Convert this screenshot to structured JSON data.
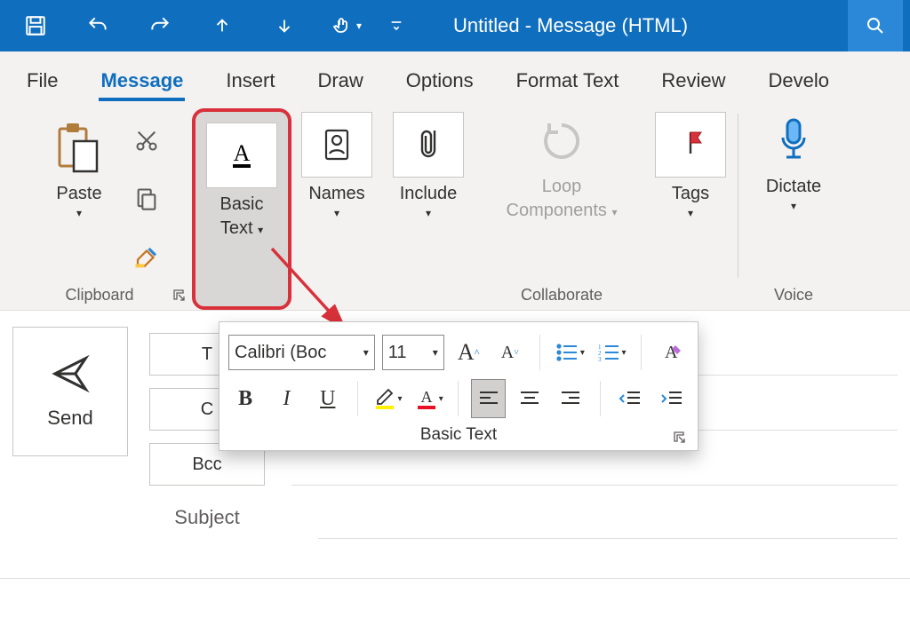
{
  "title": "Untitled  -  Message (HTML)",
  "tabs": {
    "file": "File",
    "message": "Message",
    "insert": "Insert",
    "draw": "Draw",
    "options": "Options",
    "format_text": "Format Text",
    "review": "Review",
    "developer": "Develo"
  },
  "ribbon": {
    "clipboard": {
      "paste": "Paste",
      "label": "Clipboard"
    },
    "basic_text": {
      "btn_line1": "Basic",
      "btn_line2": "Text"
    },
    "names": "Names",
    "include": "Include",
    "loop": {
      "line1": "Loop",
      "line2": "Components"
    },
    "collaborate_label": "Collaborate",
    "tags": "Tags",
    "dictate": "Dictate",
    "voice_label": "Voice"
  },
  "compose": {
    "send": "Send",
    "to_prefix": "T",
    "cc_prefix": "C",
    "bcc": "Bcc",
    "subject": "Subject"
  },
  "panel": {
    "font_name": "Calibri (Boc",
    "font_size": "11",
    "title": "Basic Text"
  }
}
